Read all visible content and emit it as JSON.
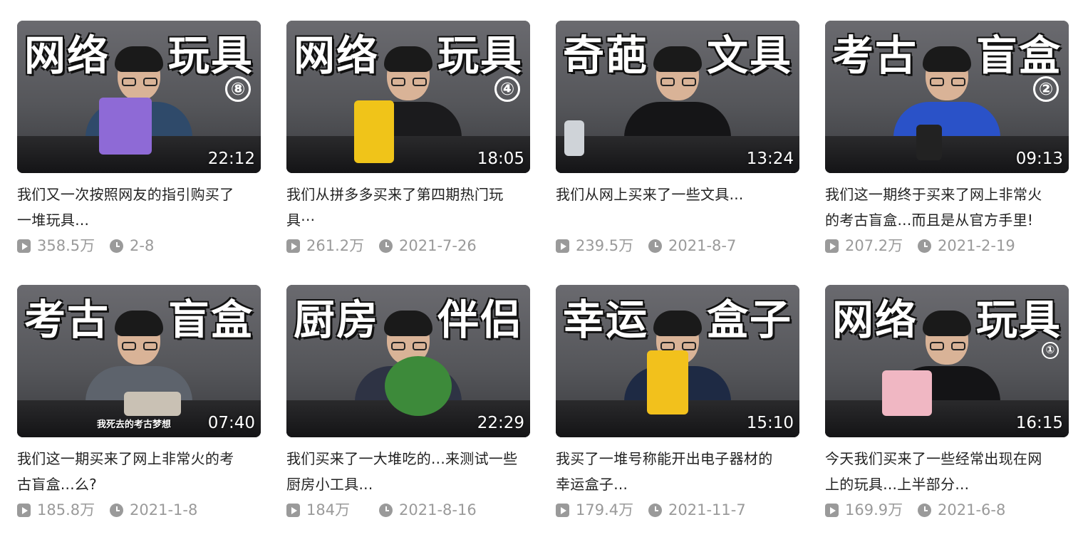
{
  "videos": [
    {
      "thumb_words": [
        "网络",
        "玩具"
      ],
      "episode_badge": "⑧",
      "duration": "22:12",
      "title_lines": [
        "我们又一次按照网友的指引购买了",
        "一堆玩具..."
      ],
      "views": "358.5万",
      "date": "2-8",
      "shirt_color": "#2f4a6a",
      "prop_color": "#8e6ad6"
    },
    {
      "thumb_words": [
        "网络",
        "玩具"
      ],
      "episode_badge": "④",
      "duration": "18:05",
      "title_lines": [
        "我们从拼多多买来了第四期热门玩",
        "具···"
      ],
      "views": "261.2万",
      "date": "2021-7-26",
      "shirt_color": "#1b1b1d",
      "prop_color": "#f0c419"
    },
    {
      "thumb_words": [
        "奇葩",
        "文具"
      ],
      "episode_badge": "",
      "duration": "13:24",
      "title_lines": [
        "我们从网上买来了一些文具...",
        ""
      ],
      "views": "239.5万",
      "date": "2021-8-7",
      "shirt_color": "#151517",
      "prop_color": "#cfd3d8"
    },
    {
      "thumb_words": [
        "考古",
        "盲盒"
      ],
      "episode_badge": "②",
      "duration": "09:13",
      "title_lines": [
        "我们这一期终于买来了网上非常火",
        "的考古盲盒...而且是从官方手里!"
      ],
      "views": "207.2万",
      "date": "2021-2-19",
      "shirt_color": "#2a52c8",
      "prop_color": "#222222"
    },
    {
      "thumb_words": [
        "考古",
        "盲盒"
      ],
      "episode_badge": "",
      "duration": "07:40",
      "subtitle": "我死去的考古梦想",
      "title_lines": [
        "我们这一期买来了网上非常火的考",
        "古盲盒...么?"
      ],
      "views": "185.8万",
      "date": "2021-1-8",
      "shirt_color": "#5d636c",
      "prop_color": "#c9c1b4"
    },
    {
      "thumb_words": [
        "厨房",
        "伴侣"
      ],
      "episode_badge": "",
      "duration": "22:29",
      "title_lines": [
        "我们买来了一大堆吃的...来测试一些",
        "厨房小工具..."
      ],
      "views": "184万",
      "date": "2021-8-16",
      "shirt_color": "#2e3344",
      "prop_color": "#3d8a3a"
    },
    {
      "thumb_words": [
        "幸运",
        "盒子"
      ],
      "episode_badge": "",
      "duration": "15:10",
      "title_lines": [
        "我买了一堆号称能开出电子器材的",
        "幸运盒子..."
      ],
      "views": "179.4万",
      "date": "2021-11-7",
      "shirt_color": "#1e2a44",
      "prop_color": "#f2c11c"
    },
    {
      "thumb_words": [
        "网络",
        "玩具"
      ],
      "episode_badge": "①",
      "duration": "16:15",
      "title_lines": [
        "今天我们买来了一些经常出现在网",
        "上的玩具...上半部分..."
      ],
      "views": "169.9万",
      "date": "2021-6-8",
      "shirt_color": "#141416",
      "prop_color": "#f0b7c3"
    }
  ]
}
